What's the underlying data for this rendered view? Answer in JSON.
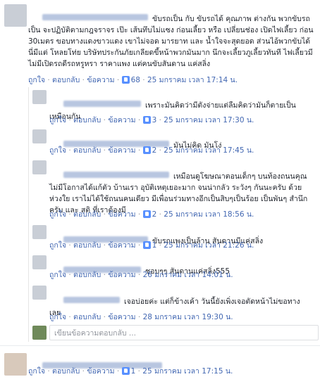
{
  "actions": {
    "like": "ถูกใจ",
    "reply": "ตอบกลับ",
    "edit": "ข้อความ",
    "sep": "·"
  },
  "comments": [
    {
      "text": "ขับรถเป็น กับ ขับรถได้ คุณภาพ ต่างกัน พวกขับรถเป็น จะปฏิบัติตามกฎจราจร เป๊ะ เส้นทึบไม่แซง ก่อนเลี้ยว หรือ เปลี่ยนช่อง เปิดไฟเลี้ยว ก่อน 30เมตร ขอบทางแดงขาวแดง เขาไม่จอด มารยาท และ น้ำใจจะสุดยอด ส่วนไอ้พวกขับได้ นี่มีแต่ โหลยโท่ย บริษัทประกันภัยเกลียดขี้หน้าพวกมันมาก นึกจะเลี้ยวภูเลี้ยวทันที ไฟเลี้ยวมีไม่มีเปิดรถดีรถหรูหรา ราคาแพง แต่คนขับสันดาน แค่สลิ่ง",
      "likes": "68",
      "time": "25 มกราคม เวลา 17:14 น."
    },
    {
      "text": "เพราะมันคิดว่ามีตังจ่ายแต่ลืมคิดว่ามันก็ตายเป็นเหมือนกัน",
      "likes": "3",
      "time": "25 มกราคม เวลา 17:30 น."
    },
    {
      "text": "มันไม่คิด มันโง่",
      "likes": "2",
      "time": "25 มกราคม เวลา 17:45 น."
    },
    {
      "text": "เหมือนดูโฆษณาตอนเด็กๆ บนท้องถนนคุณไม่มีโอกาสได้แก้ตัว บ้านเรา อุบัติเหตุเยอะมาก จนน่ากลัว ระวังๆ กันนะครับ ด้วยห่วงใย เราไม่ได้ใช้ถนนคนเดียว มีเพื่อนร่วมทางอีกเป็นสิบๆเป็นร้อย เป็นพันๆ สำนึกครับ และ สติ ที่เราต้องมี",
      "likes": "2",
      "time": "25 มกราคม เวลา 18:56 น."
    },
    {
      "text": "ขับรถแพงเป็นล้าน สันดานมีแค่สลิ่ง",
      "likes": "1",
      "time": "25 มกราคม เวลา 21:26 น."
    },
    {
      "text": "ชอบๆๆ สันดานแค่สลิ่ง555",
      "likes": "",
      "time": "26 มกราคม เวลา 14:01 น."
    },
    {
      "text": "เจอบ่อยค่ะ แต่ก็ข้างเค้า วันนี้ยังเพิ่งเจอตัดหน้าไม่ขอทางเลย",
      "likes": "",
      "time": "28 มกราคม เวลา 19:30 น."
    },
    {
      "text": "",
      "likes": "1",
      "time": "25 มกราคม เวลา 17:15 น."
    }
  ],
  "reply_box": {
    "placeholder": "เขียนข้อความตอบกลับ ..."
  },
  "colors": {
    "link": "#4267b2",
    "meta": "#90949c",
    "text": "#1d2129",
    "like_icon": "#5890ff"
  }
}
